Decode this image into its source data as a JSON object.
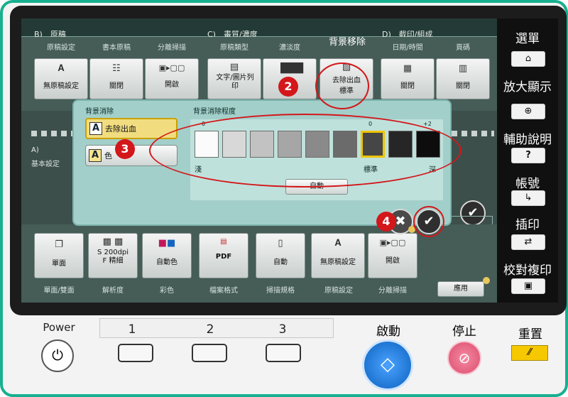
{
  "tabs": {
    "b": "B)　原稿",
    "c": "C)　畫質/濃度",
    "d": "D)　截印/組成"
  },
  "top_labels": [
    "原稿設定",
    "書本原稿",
    "分離掃描",
    "原稿類型",
    "濃淡度",
    "背景移除",
    "日期/時間",
    "頁碼"
  ],
  "top_tiles": {
    "originals": "無原稿設定",
    "book": "關閉",
    "separate": "開啟",
    "type": "文字/圖片列印",
    "bg_removal_1": "去除出血",
    "bg_removal_2": "標準",
    "date": "關閉",
    "page": "關閉"
  },
  "left_area": {
    "a_label": "A)",
    "a_sub": "基本設定"
  },
  "dialog": {
    "left_title": "背景消除",
    "opt1": "去除出血",
    "opt2": "色",
    "level_title": "背景消除程度",
    "zero_left": "0",
    "zero_right": "0",
    "plus_two": "+2",
    "light": "淺",
    "standard": "標準",
    "dark": "深",
    "auto": "自動"
  },
  "swatch_colors": [
    "#fbfbfb",
    "#d8d8d8",
    "#c2c2c2",
    "#a6a6a6",
    "#8a8a8a",
    "#6b6b6b",
    "#464646",
    "#262626",
    "#0d0d0d"
  ],
  "selected_level_index": 6,
  "bottom_tiles": [
    "單面",
    "S 200dpi\nF 精細",
    "自動色",
    "PDF",
    "自動",
    "無原稿設定",
    "開啟"
  ],
  "bottom_tile_icons": [
    "duplex-icon",
    "resolution-icon",
    "color-icon",
    "pdf-icon",
    "paper-icon",
    "originals-icon",
    "separate-scan-icon"
  ],
  "bottom_labels": [
    "單面/雙面",
    "解析度",
    "彩色",
    "檔案格式",
    "掃描規格",
    "原稿設定",
    "分離掃描"
  ],
  "apply_label": "應用",
  "annotations": [
    "2",
    "3",
    "4"
  ],
  "right_panel": {
    "menu": "選單",
    "zoom": "放大顯示",
    "help": "輔助說明",
    "account": "帳號",
    "interrupt": "插印",
    "proof": "校對複印"
  },
  "hardware": {
    "power": "Power",
    "key1": "1",
    "key2": "2",
    "key3": "3",
    "start": "啟動",
    "stop": "停止",
    "reset": "重置"
  },
  "colors": {
    "bezel": "#18b08f",
    "annotation": "#d3171a",
    "start_button": "#1f76d2",
    "stop_button": "#e35f7d",
    "reset_button": "#f5c800",
    "dialog_bg": "#a3cfca"
  }
}
